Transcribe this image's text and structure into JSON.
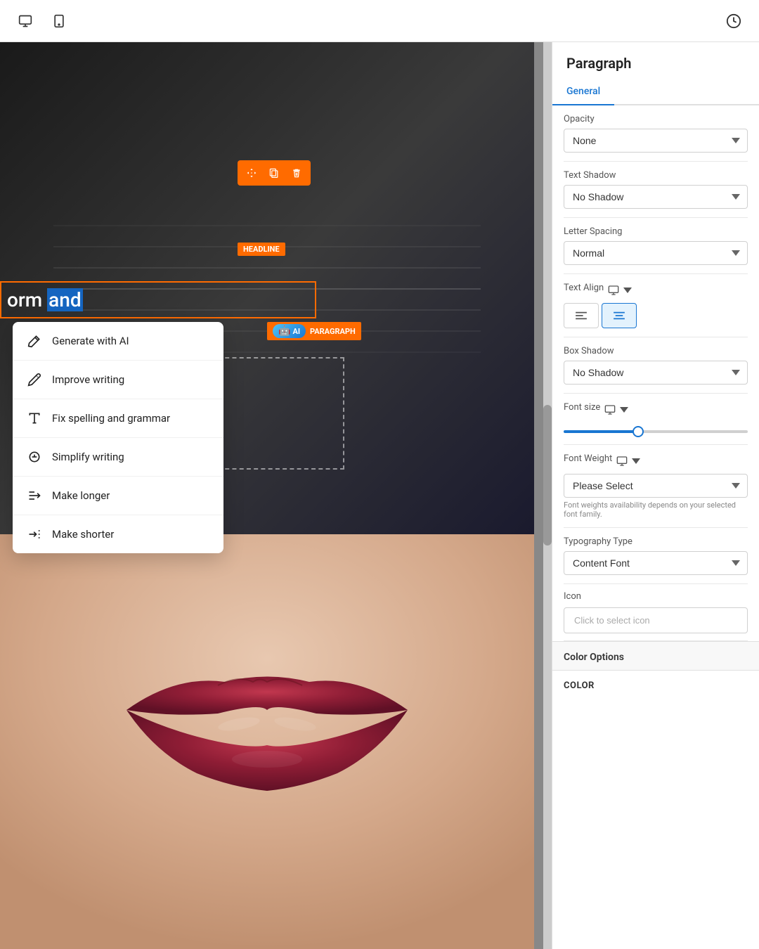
{
  "toolbar": {
    "desktop_icon": "desktop-icon",
    "mobile_icon": "mobile-icon",
    "history_icon": "history-icon"
  },
  "float_toolbar": {
    "move_icon": "move-icon",
    "copy_icon": "copy-icon",
    "delete_icon": "delete-icon"
  },
  "badges": {
    "headline": "HEADLINE",
    "paragraph": "PARAGRAPH",
    "ai": "AI"
  },
  "selected_text": {
    "before_highlight": "orm ",
    "highlighted": "and",
    "after_highlight": ""
  },
  "context_menu": {
    "items": [
      {
        "id": "generate-ai",
        "icon": "wand-icon",
        "label": "Generate with AI"
      },
      {
        "id": "improve-writing",
        "icon": "pencil-icon",
        "label": "Improve writing"
      },
      {
        "id": "fix-spelling",
        "icon": "type-icon",
        "label": "Fix spelling and grammar"
      },
      {
        "id": "simplify-writing",
        "icon": "simplify-icon",
        "label": "Simplify writing"
      },
      {
        "id": "make-longer",
        "icon": "longer-icon",
        "label": "Make longer"
      },
      {
        "id": "make-shorter",
        "icon": "shorter-icon",
        "label": "Make shorter"
      }
    ]
  },
  "right_panel": {
    "title": "Paragraph",
    "tabs": [
      {
        "id": "general",
        "label": "General",
        "active": true
      }
    ],
    "opacity": {
      "label": "Opacity",
      "value": "None"
    },
    "text_shadow": {
      "label": "Text Shadow",
      "value": "No Shadow"
    },
    "letter_spacing": {
      "label": "Letter Spacing",
      "value": "Normal"
    },
    "text_align": {
      "label": "Text Align",
      "buttons": [
        {
          "id": "align-left",
          "icon": "align-left-icon",
          "active": false
        },
        {
          "id": "align-center",
          "icon": "align-center-icon",
          "active": true
        }
      ]
    },
    "box_shadow": {
      "label": "Box Shadow",
      "value": "No Shadow"
    },
    "font_size": {
      "label": "Font size",
      "slider_value": 40
    },
    "font_weight": {
      "label": "Font Weight",
      "placeholder": "Please Select"
    },
    "font_weight_hint": "Font weights availability depends on your selected font family.",
    "typography_type": {
      "label": "Typography Type",
      "value": "Content Font"
    },
    "icon": {
      "label": "Icon",
      "placeholder": "Click to select icon"
    },
    "color_options": {
      "header": "Color Options",
      "color_label": "COLOR"
    }
  }
}
